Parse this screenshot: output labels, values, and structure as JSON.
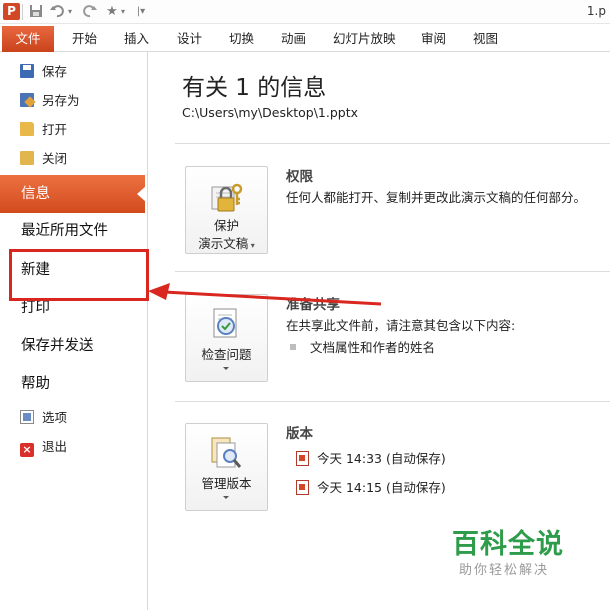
{
  "window": {
    "title": "1.p",
    "app_icon_letter": "P"
  },
  "quick_access": [
    "save-icon",
    "undo-icon",
    "redo-icon",
    "star-icon",
    "customize-icon"
  ],
  "ribbon": {
    "file_tab": "文件",
    "tabs": [
      "开始",
      "插入",
      "设计",
      "切换",
      "动画",
      "幻灯片放映",
      "审阅",
      "视图"
    ]
  },
  "nav": {
    "save": "保存",
    "save_as": "另存为",
    "open": "打开",
    "close": "关闭",
    "info": "信息",
    "recent": "最近所用文件",
    "new": "新建",
    "print": "打印",
    "save_send": "保存并发送",
    "help": "帮助",
    "options": "选项",
    "exit": "退出"
  },
  "info": {
    "title": "有关 1 的信息",
    "path": "C:\\Users\\my\\Desktop\\1.pptx",
    "permissions": {
      "button_line1": "保护",
      "button_line2": "演示文稿",
      "heading": "权限",
      "description": "任何人都能打开、复制并更改此演示文稿的任何部分。"
    },
    "prepare": {
      "button_label": "检查问题",
      "heading": "准备共享",
      "description": "在共享此文件前，请注意其包含以下内容:",
      "bullet": "文档属性和作者的姓名"
    },
    "versions": {
      "button_label": "管理版本",
      "heading": "版本",
      "entries": [
        "今天 14:33 (自动保存)",
        "今天 14:15 (自动保存)"
      ]
    }
  },
  "annotation": {
    "color": "#d9261e"
  },
  "watermark": {
    "main": "百科全说",
    "sub": "助你轻松解决"
  },
  "colors": {
    "accent": "#d24726",
    "watermark_green": "#2e9c4b"
  }
}
